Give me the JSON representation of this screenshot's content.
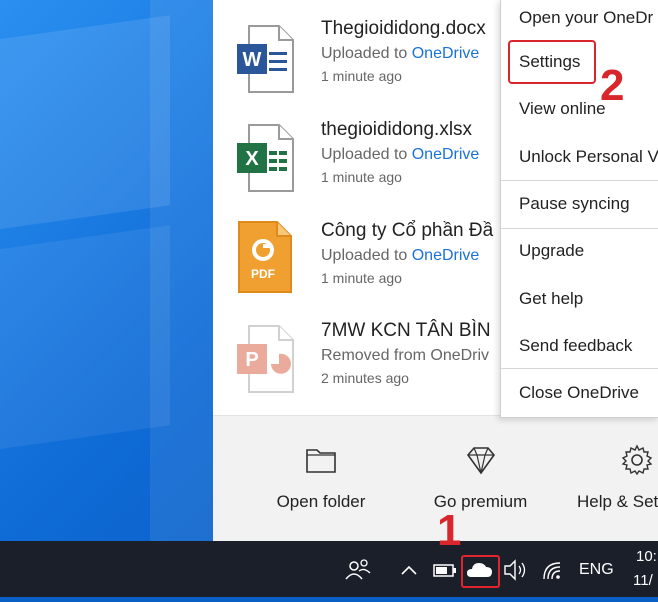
{
  "files": [
    {
      "name": "Thegioididong.docx",
      "status_prefix": "Uploaded to ",
      "status_link": "OneDrive",
      "time": "1 minute ago",
      "type": "word-icon"
    },
    {
      "name": "thegioididong.xlsx",
      "status_prefix": "Uploaded to ",
      "status_link": "OneDrive",
      "time": "1 minute ago",
      "type": "excel-icon"
    },
    {
      "name": "Công ty Cổ phần Đầ",
      "status_prefix": "Uploaded to ",
      "status_link": "OneDrive",
      "time": "1 minute ago",
      "type": "pdf-icon"
    },
    {
      "name": "7MW KCN TÂN BÌN",
      "status_prefix": "Removed from OneDriv",
      "status_link": "",
      "time": "2 minutes ago",
      "type": "powerpoint-icon"
    }
  ],
  "bottom_bar": {
    "open_folder": "Open folder",
    "go_premium": "Go premium",
    "help_settings": "Help & Set"
  },
  "menu": {
    "open_onedrive": "Open your OneDr",
    "settings": "Settings",
    "view_online": "View online",
    "unlock_vault": "Unlock Personal V",
    "pause_syncing": "Pause syncing",
    "upgrade": "Upgrade",
    "get_help": "Get help",
    "send_feedback": "Send feedback",
    "close_onedrive": "Close OneDrive"
  },
  "annotations": {
    "step1": "1",
    "step2": "2"
  },
  "taskbar": {
    "language": "ENG",
    "time": "10:",
    "date": "11/"
  },
  "colors": {
    "accent_link": "#1a73d9",
    "highlight_red": "#d9262c",
    "taskbar": "#1b1f2a"
  }
}
